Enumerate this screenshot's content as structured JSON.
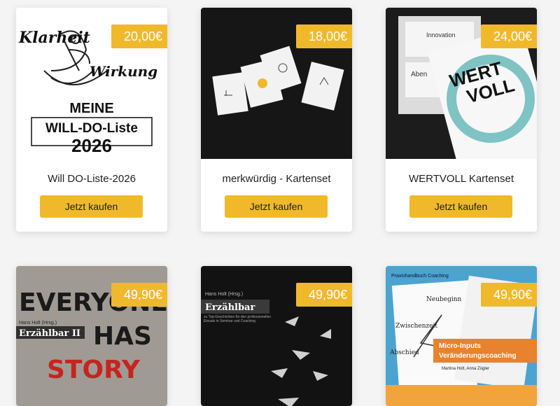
{
  "products": [
    {
      "title": "Will DO-Liste-2026",
      "price": "20,00€",
      "button": "Jetzt kaufen",
      "image_text": {
        "line1": "Klarheit",
        "line2": "Wirkung",
        "heading": "MEINE",
        "box": "WILL-DO-Liste",
        "year": "2026"
      }
    },
    {
      "title": "merkwürdig - Kartenset",
      "price": "18,00€",
      "button": "Jetzt kaufen"
    },
    {
      "title": "WERTVOLL Kartenset",
      "price": "24,00€",
      "button": "Jetzt kaufen",
      "image_text": {
        "card1": "Innovation",
        "card2": "Aben",
        "logo1": "WERT",
        "logo2": "VOLL"
      }
    },
    {
      "price": "49,90€",
      "image_text": {
        "wall1": "EVERYONE",
        "wall2": "HAS",
        "wall3": "STORY",
        "author": "Hans Holt (Hrsg.)",
        "book": "Erzählbar II"
      }
    },
    {
      "price": "49,90€",
      "image_text": {
        "author": "Hans Holt (Hrsg.)",
        "book": "Erzählbar",
        "subtitle": "zu Top-Geschichten für den professionellen Einsatz in Seminar und Coaching"
      }
    },
    {
      "price": "49,90€",
      "image_text": {
        "series": "Praxishandbuch Coaching",
        "w1": "Neubeginn",
        "w2": "Zwischenzeit",
        "w3": "Abschied",
        "book1": "Micro-Inputs",
        "book2": "Veränderungscoaching",
        "authors": "Martina Holt, Anna Zügler"
      }
    }
  ]
}
